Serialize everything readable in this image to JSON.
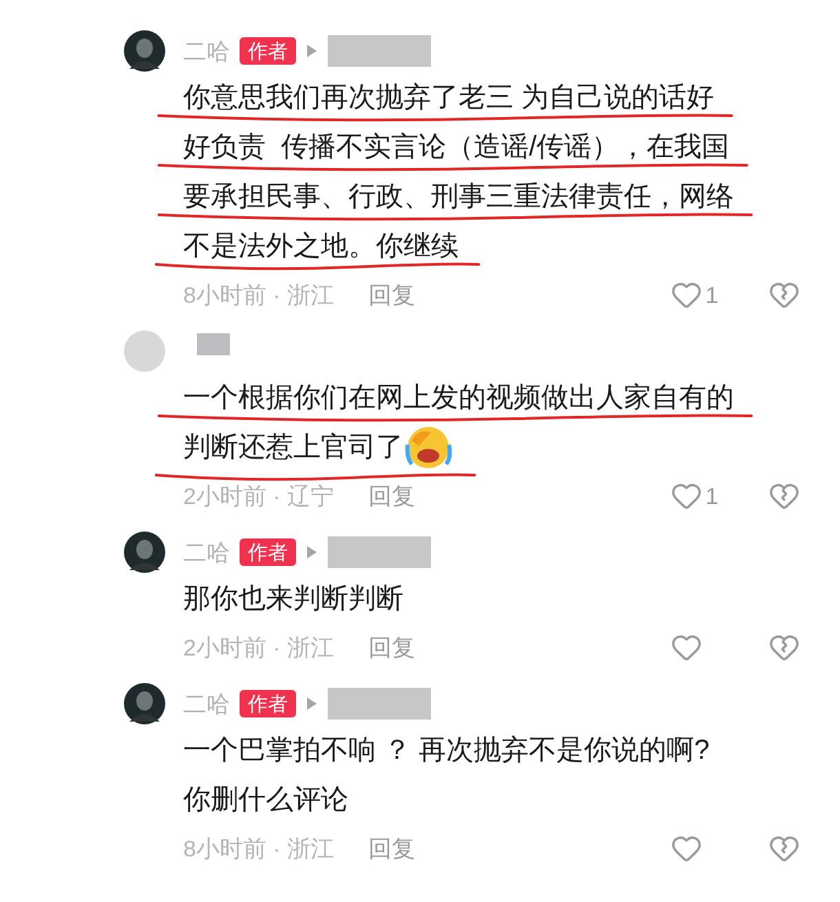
{
  "comments": [
    {
      "author": {
        "name": "二哈",
        "badge": "作者",
        "kind": "author"
      },
      "lines": [
        {
          "text": "你意思我们再次抛弃了老三 为自己说的话好",
          "underlined": true
        },
        {
          "text": "好负责  传播不实言论（造谣/传谣），在我国",
          "underlined": true
        },
        {
          "text": "要承担民事、行政、刑事三重法律责任，网络",
          "underlined": true
        },
        {
          "text": "不是法外之地。你继续",
          "underlined": true
        }
      ],
      "emoji": false,
      "time": "8小时前 · 浙江",
      "reply": "回复",
      "likes": "1"
    },
    {
      "author": {
        "kind": "hidden"
      },
      "lines": [
        {
          "text": "一个根据你们在网上发的视频做出人家自有的",
          "underlined": true
        },
        {
          "text": "判断还惹上官司了",
          "underlined": true
        }
      ],
      "emoji": true,
      "time": "2小时前 · 辽宁",
      "reply": "回复",
      "likes": "1"
    },
    {
      "author": {
        "name": "二哈",
        "badge": "作者",
        "kind": "author"
      },
      "lines": [
        {
          "text": "那你也来判断判断",
          "underlined": false
        }
      ],
      "emoji": false,
      "time": "2小时前 · 浙江",
      "reply": "回复"
    },
    {
      "author": {
        "name": "二哈",
        "badge": "作者",
        "kind": "author"
      },
      "lines": [
        {
          "text": "一个巴掌拍不响 ？ 再次抛弃不是你说的啊?",
          "underlined": false
        },
        {
          "text": "你删什么评论",
          "underlined": false
        }
      ],
      "emoji": false,
      "time": "8小时前 · 浙江",
      "reply": "回复"
    }
  ]
}
